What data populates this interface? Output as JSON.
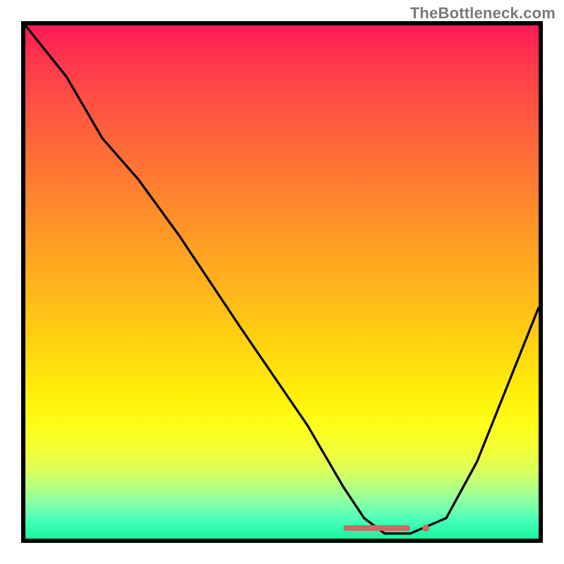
{
  "watermark": "TheBottleneck.com",
  "chart_data": {
    "type": "line",
    "title": "",
    "xlabel": "",
    "ylabel": "",
    "xlim": [
      0,
      100
    ],
    "ylim": [
      0,
      100
    ],
    "grid": false,
    "legend": false,
    "series": [
      {
        "name": "curve",
        "x": [
          0,
          8,
          15,
          22,
          30,
          42,
          55,
          62,
          66,
          70,
          75,
          82,
          88,
          94,
          100
        ],
        "y": [
          100,
          90,
          78,
          70,
          59,
          41,
          22,
          10,
          4,
          1,
          1,
          4,
          15,
          30,
          45
        ]
      }
    ],
    "marker_strip": {
      "x_start": 62,
      "x_end": 75,
      "y": 2
    },
    "marker_dot": {
      "x": 78,
      "y": 2
    },
    "background": "red-green-vertical-gradient"
  }
}
